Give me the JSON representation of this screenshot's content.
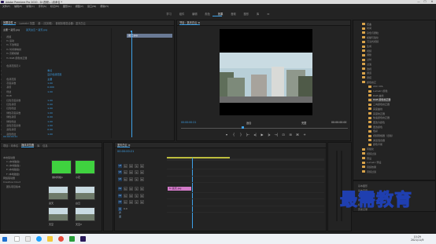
{
  "window": {
    "title": "Adobe Premiere Pro 2020 - D:\\视频\\...\\未命名 *",
    "minimize": "—",
    "maximize": "☐",
    "close": "✕"
  },
  "menu": [
    "文件(F)",
    "编辑(E)",
    "剪辑(C)",
    "序列(S)",
    "标记(M)",
    "图形(G)",
    "视图(V)",
    "窗口(W)",
    "帮助(H)"
  ],
  "workspaces": [
    "学习",
    "组件",
    "编辑",
    "颜色",
    "效果",
    "音频",
    "图形",
    "库",
    "≫"
  ],
  "active_workspace": "效果",
  "effect_controls": {
    "tabs": [
      "效果控件 ≡",
      "Lumetri 范围",
      "源：(无剪辑)",
      "音频剪辑混合器：蓝天白云"
    ],
    "source_line": "主要 * 蓝天.jpg",
    "seq_line": "蓝天白云 * 蓝天.jpg",
    "clip_chip": "蓝天.jpg",
    "rows": [
      {
        "label": "视频",
        "value": ""
      },
      {
        "label": "fx 运动",
        "value": ""
      },
      {
        "label": "fx 不透明度",
        "value": ""
      },
      {
        "label": "fx 时间重映射",
        "value": ""
      },
      {
        "label": "fx 高斯模糊",
        "value": ""
      },
      {
        "label": "fx RGB 颜色校正器",
        "value": ""
      },
      {
        "label": "",
        "value": ""
      },
      {
        "label": "色调范围定义",
        "value": ""
      },
      {
        "label": "",
        "value": "重点"
      },
      {
        "label": "",
        "value": "显示色调范围"
      },
      {
        "label": "色调范围",
        "value": "主要"
      },
      {
        "label": "灰度系数",
        "value": "1.00"
      },
      {
        "label": "基值",
        "value": "0.000"
      },
      {
        "label": "增益",
        "value": "1.00"
      },
      {
        "label": "RGB",
        "value": ""
      },
      {
        "label": "红色灰度系数",
        "value": "1.00"
      },
      {
        "label": "红色基值",
        "value": "0.00"
      },
      {
        "label": "红色增益",
        "value": "1.00"
      },
      {
        "label": "绿色灰度系数",
        "value": "1.00"
      },
      {
        "label": "绿色基值",
        "value": "0.00"
      },
      {
        "label": "绿色增益",
        "value": "1.00"
      },
      {
        "label": "蓝色灰度系数",
        "value": "1.00"
      },
      {
        "label": "蓝色基值",
        "value": "0.00"
      },
      {
        "label": "蓝色增益",
        "value": "1.00"
      }
    ],
    "timecode": "00:00:00:21"
  },
  "program": {
    "tab": "节目：蓝天白云 ≡",
    "timecode": "00:00:00:21",
    "fit": "适合",
    "ratio": "完整",
    "end_timecode": "00:00:00:00",
    "controls": [
      "▾",
      "{",
      "}",
      "|←",
      "◂|",
      "▶",
      "|▸",
      "→|",
      "⊡",
      "⊞",
      "⌘",
      "+"
    ]
  },
  "project": {
    "tabs": [
      "项目：未命名",
      "媒体浏览器",
      "库",
      "信息"
    ],
    "tree": [
      "本地驱动器",
      "C (本地磁盘)",
      "D (本地磁盘)",
      "E (本地磁盘)",
      "F (本地磁盘)",
      "网络驱动器",
      "Creative Cloud",
      "团队项目版本"
    ],
    "clips": [
      {
        "name": "素材风格1",
        "type": "green"
      },
      {
        "name": "小花",
        "type": "green"
      },
      {
        "name": "蓝天",
        "type": "photo"
      },
      {
        "name": "白云",
        "type": "photo"
      },
      {
        "name": "天空",
        "type": "photo"
      },
      {
        "name": "天空2",
        "type": "photo"
      }
    ]
  },
  "timeline": {
    "tab": "蓝天白云 ≡",
    "timecode": "00:00:00:21",
    "tracks": [
      {
        "name": "V3",
        "kind": "v"
      },
      {
        "name": "V2",
        "kind": "v"
      },
      {
        "name": "V1",
        "kind": "v"
      },
      {
        "name": "A1",
        "kind": "a"
      },
      {
        "name": "A2",
        "kind": "a"
      },
      {
        "name": "A3",
        "kind": "a"
      },
      {
        "name": "主声道",
        "kind": "m"
      }
    ],
    "master_value": "0.0",
    "clip_label": "fx 蓝天.jpg",
    "track_buttons": [
      "fx",
      "M",
      "S",
      "B"
    ]
  },
  "effects_panel": {
    "items": [
      "扭曲",
      "时间",
      "杂色与颗粒",
      "模糊与锐化",
      "沉浸式视频",
      "生成",
      "视频",
      "调整",
      "过时",
      "过渡",
      "透视",
      "通道",
      "键控",
      "颜色校正",
      "ASC CDL",
      "Lumetri 颜色",
      "RGB 曲线",
      "RGB 颜色校正器",
      "三向颜色校正器",
      "亮度曲线",
      "亮度校正器",
      "快速颜色校正器",
      "更改为颜色",
      "更改颜色",
      "色彩",
      "视频限幅器（旧版）",
      "通道混合器",
      "颜色平衡",
      "风格化",
      "视频过渡",
      "预设",
      "Lumetri 预设",
      "音频效果",
      "音频过渡"
    ],
    "bottom": [
      "基本图形",
      "基本声音",
      "Lumetri 颜色",
      "库",
      "标记",
      "历史记录"
    ]
  },
  "taskbar": {
    "time": "10:29",
    "date": "2021/11/9"
  },
  "watermark": "最需教育"
}
